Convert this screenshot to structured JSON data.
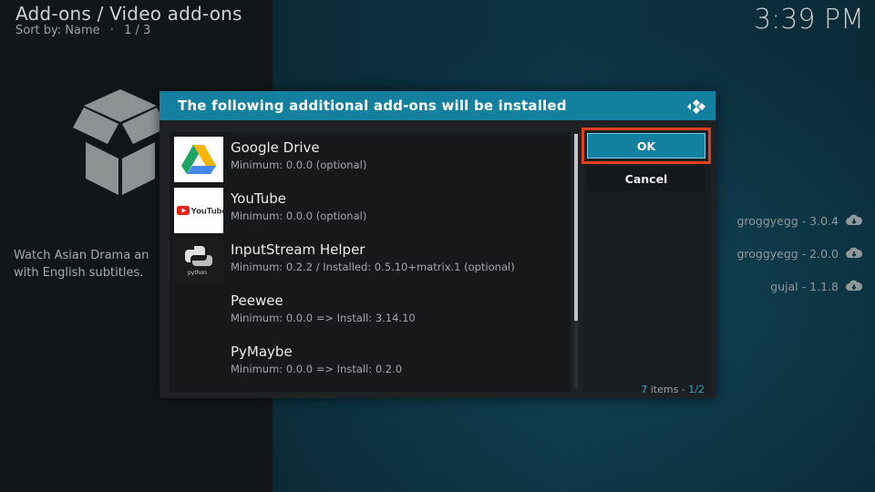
{
  "header": {
    "title": "Add-ons / Video add-ons",
    "sort_label": "Sort by: Name",
    "separator": "·",
    "page": "1 / 3",
    "clock": "3:39 PM"
  },
  "background": {
    "description": "Watch Asian Drama and Movies with English subtitles.",
    "description_line1": "Watch Asian Drama an",
    "description_line2": "with English subtitles.",
    "list": [
      {
        "text": "groggyegg - 3.0.4",
        "icon": "cloud-download-icon"
      },
      {
        "text": "groggyegg - 2.0.0",
        "icon": "cloud-download-icon"
      },
      {
        "text": "gujal - 1.1.8",
        "icon": "cloud-download-icon"
      }
    ]
  },
  "dialog": {
    "title": "The following additional add-ons will be installed",
    "ok_label": "OK",
    "cancel_label": "Cancel",
    "count_number": "7",
    "count_label": "items",
    "count_sep": "-",
    "count_page": "1/2",
    "items": [
      {
        "name": "Google Drive",
        "detail": "Minimum: 0.0.0 (optional)",
        "icon": "google-drive-icon"
      },
      {
        "name": "YouTube",
        "detail": "Minimum: 0.0.0 (optional)",
        "icon": "youtube-icon",
        "icon_text": "YouTube"
      },
      {
        "name": "InputStream Helper",
        "detail": "Minimum: 0.2.2 / Installed: 0.5.10+matrix.1 (optional)",
        "icon": "python-icon",
        "icon_text": "python"
      },
      {
        "name": "Peewee",
        "detail": "Minimum: 0.0.0 => Install: 3.14.10"
      },
      {
        "name": "PyMaybe",
        "detail": "Minimum: 0.0.0 => Install: 0.2.0"
      }
    ]
  },
  "colors": {
    "accent": "#12809e",
    "highlight": "#e0401e",
    "youtube_red": "#e62117"
  }
}
